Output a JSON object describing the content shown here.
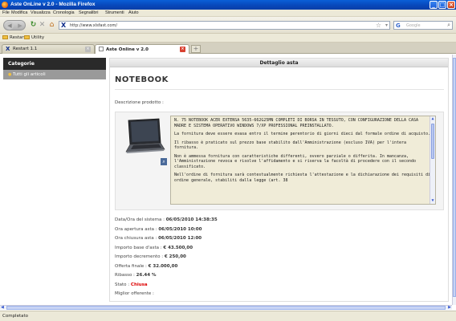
{
  "window": {
    "title": "Aste OnLine v 2.0 - Mozilla Firefox"
  },
  "menu": [
    "File",
    "Modifica",
    "Visualizza",
    "Cronologia",
    "Segnalibri",
    "Strumenti",
    "Aiuto"
  ],
  "nav": {
    "url": "http://www.xlsfast.com/",
    "search_placeholder": "Google"
  },
  "bookmarks": [
    "Restart",
    "Utility"
  ],
  "tabs": [
    {
      "label": "Restart 1.1"
    },
    {
      "label": "Aste Online v 2.0"
    }
  ],
  "sidebar": {
    "heading": "Categorie",
    "items": [
      "Tutti gli articoli"
    ]
  },
  "main": {
    "header": "Dettaglio asta",
    "product_title": "NOTEBOOK",
    "description_label": "Descrizione prodotto :",
    "description_paragraphs": [
      "N. 75 NOTEBOOK ACER EXTENSA 5635-662G25MN COMPLETI DI BORSA IN TESSUTO, CON CONFIGURAZIONE DELLA CASA MADRE E SISTEMA OPERATIVO WINDOWS 7/XP PROFESSIONAL PREINSTALLATO.",
      "La fornitura deve essere evasa entro il termine perentorio di giorni dieci dal formale ordine di acquisto.",
      "Il ribasso è praticato sul prezzo base stabilito dall'Amministrazione (escluso IVA) per l'intera fornitura.",
      "Non è ammessa fornitura con caratteristiche differenti, ovvero parziale o differita. In mancanza, l'Amministrazione revoca e risolve l'affidamento e si riserva la facoltà di procedere con il secondo classificato.",
      "Nell'ordine di fornitura sarà contestualmente richiesta l'attestazione e la dichiarazione dei requisiti di ordine generale, stabiliti dalla legge (art. 38"
    ],
    "details": [
      {
        "label": "Data/Ora del sistema :",
        "value": "06/05/2010 14:38:35"
      },
      {
        "label": "Ora apertura asta :",
        "value": "06/05/2010 10:00"
      },
      {
        "label": "Ora chiusura asta :",
        "value": "06/05/2010 12:00"
      },
      {
        "label": "Importo base d'asta :",
        "value": "€ 43.500,00"
      },
      {
        "label": "Importo decremento :",
        "value": "€ 250,00"
      },
      {
        "label": "Offerta finale :",
        "value": "€ 32.000,00"
      },
      {
        "label": "Ribasso :",
        "value": "26.44 %"
      },
      {
        "label": "Stato :",
        "value": "Chiusa"
      },
      {
        "label": "Miglior offerente :",
        "value": ""
      }
    ]
  },
  "status": "Completato",
  "colors": {
    "titlebar": "#0a5fd8",
    "sidebar_head": "#2a2a2a",
    "sidebar_item": "#9a9a9a",
    "status_closed": "#dd0000"
  }
}
